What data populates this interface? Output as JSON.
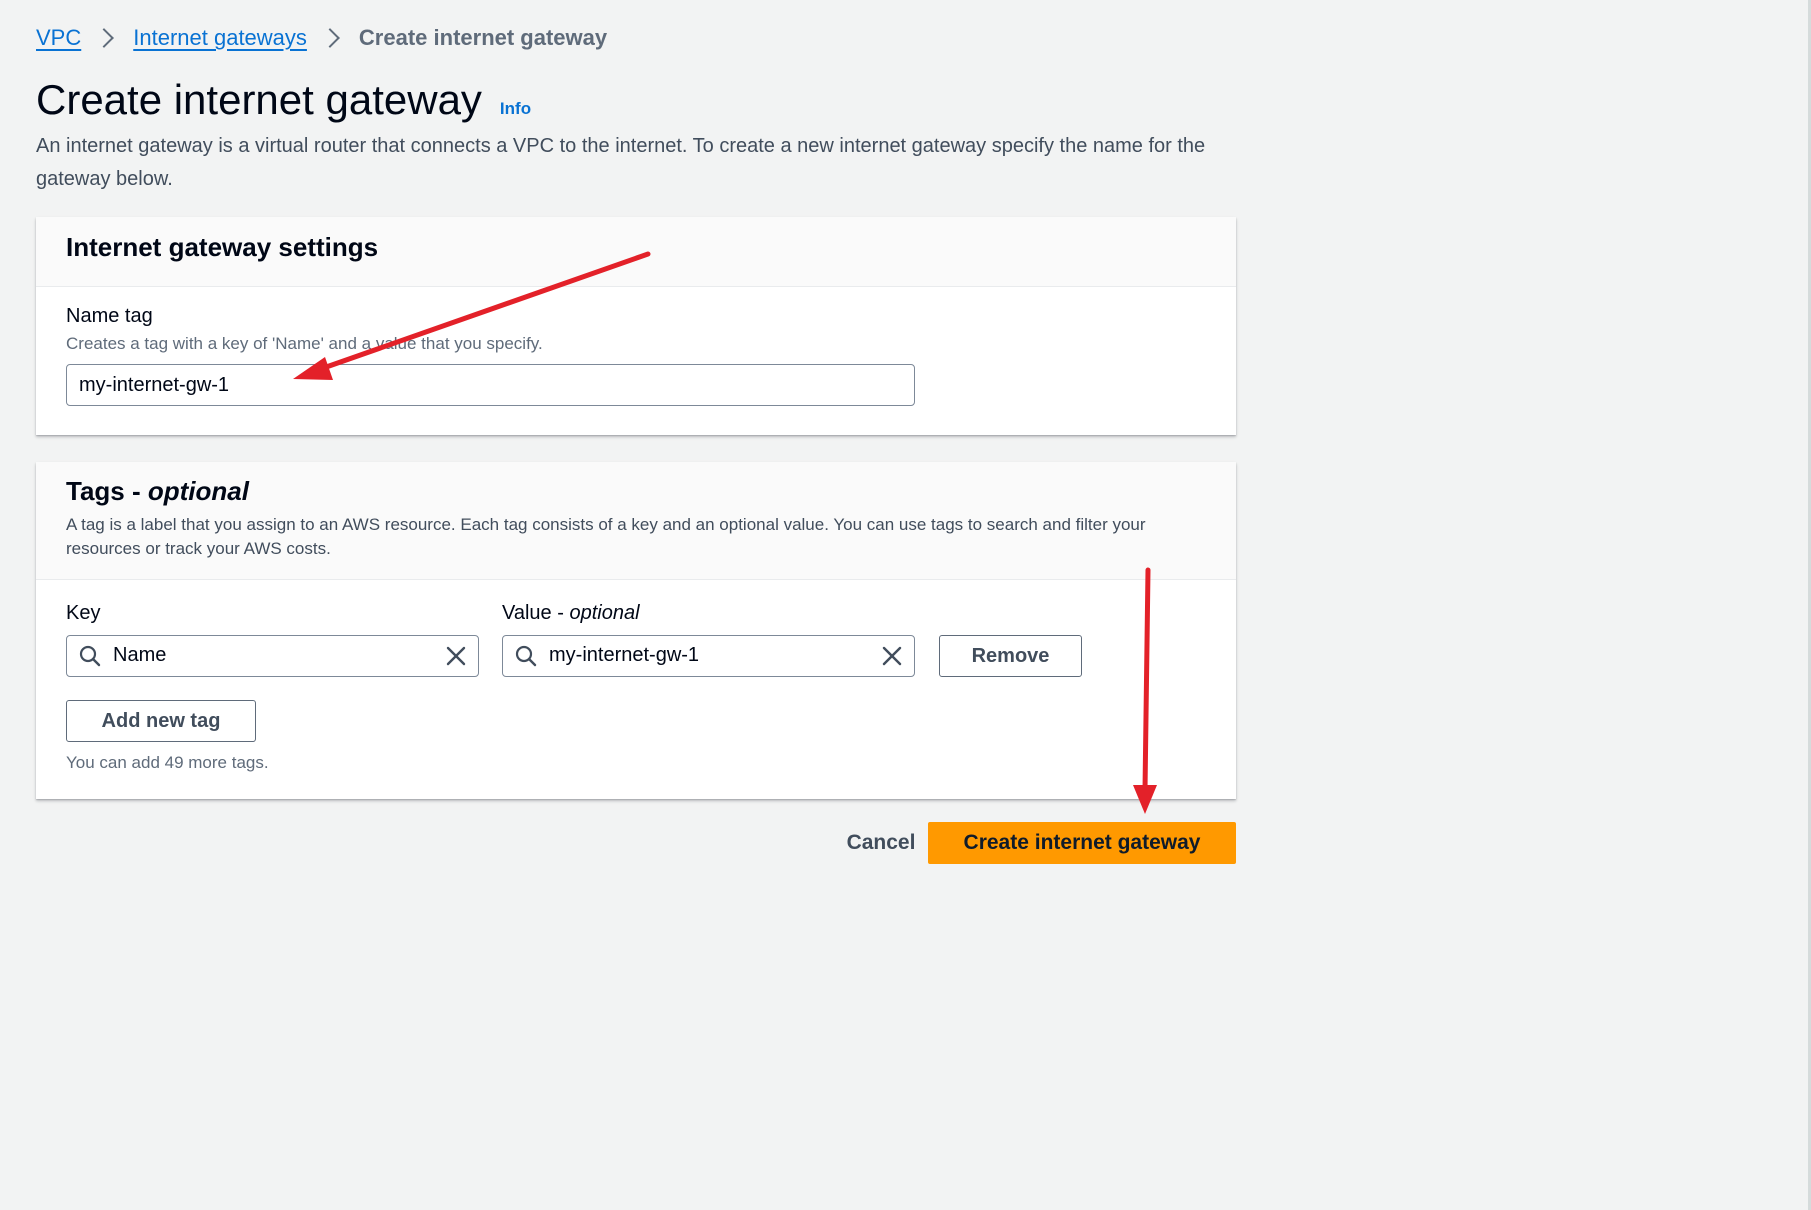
{
  "breadcrumb": {
    "items": [
      "VPC",
      "Internet gateways"
    ],
    "current": "Create internet gateway"
  },
  "page": {
    "title": "Create internet gateway",
    "info": "Info",
    "description": "An internet gateway is a virtual router that connects a VPC to the internet. To create a new internet gateway specify the name for the gateway below."
  },
  "settings": {
    "title": "Internet gateway settings",
    "name_tag": {
      "label": "Name tag",
      "hint": "Creates a tag with a key of 'Name' and a value that you specify.",
      "value": "my-internet-gw-1"
    }
  },
  "tags": {
    "title_main": "Tags - ",
    "title_optional": "optional",
    "description": "A tag is a label that you assign to an AWS resource. Each tag consists of a key and an optional value. You can use tags to search and filter your resources or track your AWS costs.",
    "key_label": "Key",
    "value_label_main": "Value - ",
    "value_label_optional": "optional",
    "rows": [
      {
        "key": "Name",
        "value": "my-internet-gw-1"
      }
    ],
    "remove_label": "Remove",
    "add_label": "Add new tag",
    "limit_note": "You can add 49 more tags."
  },
  "actions": {
    "cancel": "Cancel",
    "submit": "Create internet gateway"
  },
  "colors": {
    "primary_button": "#ff9900",
    "link": "#0972d3",
    "annotation_arrow": "#e32129",
    "background": "#f2f3f3"
  },
  "icons": [
    "chevron-right-icon",
    "search-icon",
    "clear-icon",
    "arrow-annotation"
  ]
}
